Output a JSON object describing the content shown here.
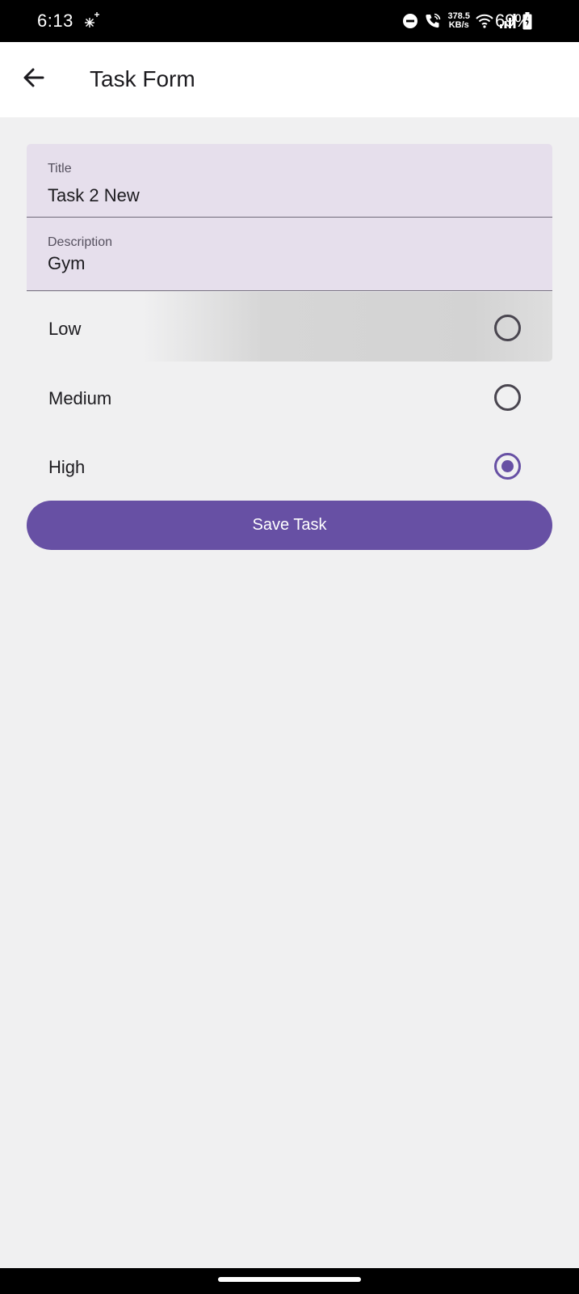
{
  "status_bar": {
    "time": "6:13",
    "net_speed_value": "378.5",
    "net_speed_unit": "KB/s",
    "battery": "69%",
    "icons": [
      "sparkle-icon",
      "dnd-icon",
      "wifi-call-icon",
      "wifi-icon",
      "signal-icon",
      "battery-icon"
    ]
  },
  "app_bar": {
    "title": "Task Form",
    "back_icon": "arrow-back-icon"
  },
  "form": {
    "title_field": {
      "label": "Title",
      "value": "Task 2 New"
    },
    "description_field": {
      "label": "Description",
      "value": "Gym"
    },
    "priority": {
      "options": [
        {
          "label": "Low",
          "selected": false
        },
        {
          "label": "Medium",
          "selected": false
        },
        {
          "label": "High",
          "selected": true
        }
      ]
    },
    "save_label": "Save Task"
  },
  "colors": {
    "primary": "#6750a4",
    "field_background": "#e6dfec",
    "page_background": "#f0f0f1"
  }
}
